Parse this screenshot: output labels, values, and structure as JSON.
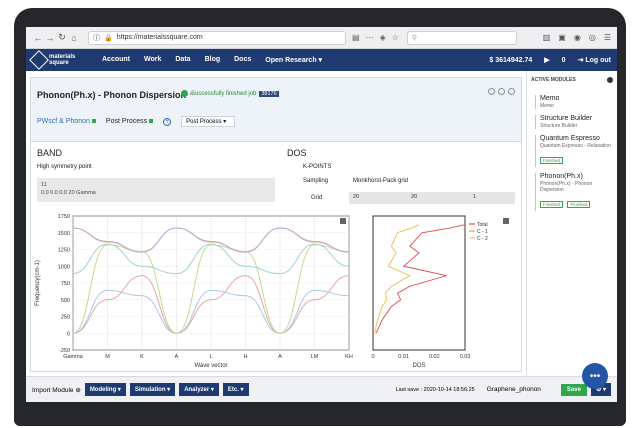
{
  "browser": {
    "url": "https://materialssquare.com",
    "search_placeholder": "Search"
  },
  "app": {
    "logo_line1": "materials",
    "logo_line2": "square",
    "menu": [
      "Account",
      "Work",
      "Data",
      "Blog",
      "Docs",
      "Open Research ▾"
    ],
    "credits": "$ 3614942.74",
    "logout": "Log out"
  },
  "panel": {
    "title": "Phonon(Ph.x) - Phonon Dispersion",
    "status": "Successfully finished job",
    "job_id": "38176",
    "tabs": [
      "PWscf & Phonon",
      "Post Process"
    ],
    "select_value": "Post Process"
  },
  "band": {
    "heading": "BAND",
    "label": "High symmetry point",
    "text_line1": "11",
    "text_line2": "0.0 0.0 0.0 20 Gamma"
  },
  "dos": {
    "heading": "DOS",
    "kpoints": "K-POINTS",
    "sampling_label": "Sampling",
    "sampling_value": "Monkhorst-Pack grid",
    "grid_label": "Grid",
    "grid_values": [
      "20",
      "20",
      "1"
    ]
  },
  "sidebar": {
    "title": "ACTIVE MODULES",
    "modules": [
      {
        "name": "Memo",
        "sub": "Memo",
        "badges": []
      },
      {
        "name": "Structure Builder",
        "sub": "Structure Builder",
        "badges": []
      },
      {
        "name": "Quantum Espresso",
        "sub": "Quantum Espresso - Relaxation",
        "badges": [
          "Finished"
        ]
      },
      {
        "name": "Phonon(Ph.x)",
        "sub": "Phonon(Ph.x) - Phonon Dispersion",
        "badges": [
          "Finished",
          "Finished"
        ]
      }
    ]
  },
  "bottom": {
    "import": "Import Module",
    "buttons": [
      "Modeling ▾",
      "Simulation ▾",
      "Analyzer ▾",
      "Etc. ▾"
    ],
    "last_save": "Last save : 2020-10-14 18:56:25",
    "project": "Graphene_phonon",
    "save": "Save"
  },
  "chart_data": [
    {
      "type": "line",
      "xlabel": "Wave vector",
      "ylabel": "Frequency(cm-1)",
      "ylim": [
        -250,
        1750
      ],
      "yticks": [
        -250,
        0,
        250,
        500,
        750,
        1000,
        1250,
        1500,
        1750
      ],
      "xticks": [
        "Gamma",
        "M",
        "K",
        "A",
        "L",
        "H",
        "A",
        "LM",
        "KH"
      ],
      "x": [
        0,
        1,
        2,
        3,
        4,
        5,
        6,
        7,
        8
      ],
      "series": [
        {
          "color": "#e9a6a6",
          "values": [
            0,
            500,
            860,
            0,
            500,
            860,
            0,
            500,
            860
          ]
        },
        {
          "color": "#a9c9e8",
          "values": [
            0,
            640,
            560,
            0,
            640,
            560,
            0,
            640,
            560
          ]
        },
        {
          "color": "#c7d98f",
          "values": [
            0,
            1320,
            1220,
            0,
            1320,
            1220,
            0,
            1320,
            1220
          ]
        },
        {
          "color": "#f2c08c",
          "values": [
            1570,
            1360,
            1220,
            1570,
            1360,
            1220,
            1570,
            1360,
            1220
          ]
        },
        {
          "color": "#b9a6de",
          "values": [
            1570,
            1370,
            1210,
            1570,
            1370,
            1210,
            1570,
            1370,
            1210
          ]
        },
        {
          "color": "#9fd6cc",
          "values": [
            890,
            1330,
            1000,
            890,
            1330,
            1000,
            890,
            1330,
            1000
          ]
        }
      ]
    },
    {
      "type": "line",
      "xlabel": "DOS",
      "xlim": [
        0,
        0.03
      ],
      "xticks": [
        "0",
        "0.01",
        "0.02",
        "0.03"
      ],
      "legend": [
        "Total",
        "C - 1",
        "C - 2"
      ],
      "legend_colors": [
        "#e24a4a",
        "#f0a040",
        "#e8d060"
      ],
      "freq": [
        0,
        200,
        400,
        500,
        600,
        700,
        860,
        1000,
        1200,
        1300,
        1400,
        1500,
        1570,
        1620
      ],
      "total": [
        0.001,
        0.003,
        0.006,
        0.009,
        0.008,
        0.012,
        0.024,
        0.01,
        0.015,
        0.012,
        0.014,
        0.016,
        0.025,
        0.03
      ],
      "c1": [
        0.0005,
        0.0015,
        0.003,
        0.0045,
        0.004,
        0.006,
        0.012,
        0.005,
        0.0075,
        0.006,
        0.007,
        0.008,
        0.0125,
        0.015
      ],
      "c2": [
        0.0005,
        0.0015,
        0.003,
        0.0045,
        0.004,
        0.006,
        0.012,
        0.005,
        0.0075,
        0.006,
        0.007,
        0.008,
        0.0125,
        0.015
      ]
    }
  ]
}
